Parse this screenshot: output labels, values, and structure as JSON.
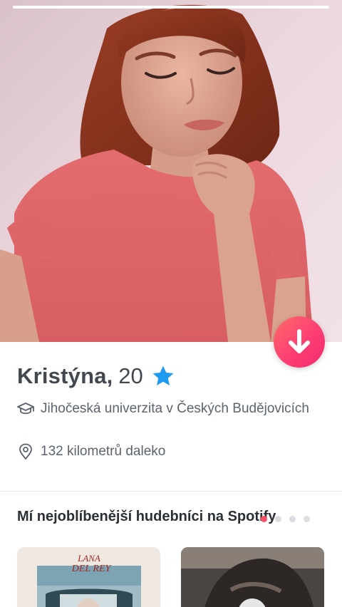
{
  "profile": {
    "name": "Kristýna",
    "name_separator": ",",
    "age": "20",
    "verified_icon": "verified-star-icon",
    "school": "Jihočeská univerzita v Českých Budějovicích",
    "school_icon": "graduation-cap-icon",
    "distance": "132 kilometrů daleko",
    "distance_icon": "location-pin-icon"
  },
  "photo": {
    "description_icon": "profile-photo",
    "photo_progress": {
      "current": 1,
      "total": 1
    }
  },
  "collapse_button": {
    "icon": "arrow-down-icon",
    "color": "#fd3f73"
  },
  "spotify": {
    "title": "Mí nejoblíbenější hudebníci na Spotify",
    "page_dots": {
      "total": 4,
      "active": 1
    },
    "albums": [
      {
        "artist_logo_text": "LANA DEL REY",
        "icon": "album-cover"
      },
      {
        "icon": "album-cover"
      }
    ]
  },
  "colors": {
    "accent": "#fd5068",
    "verified": "#1e9bf0",
    "text_primary": "#424750",
    "text_secondary": "#5c636e"
  }
}
